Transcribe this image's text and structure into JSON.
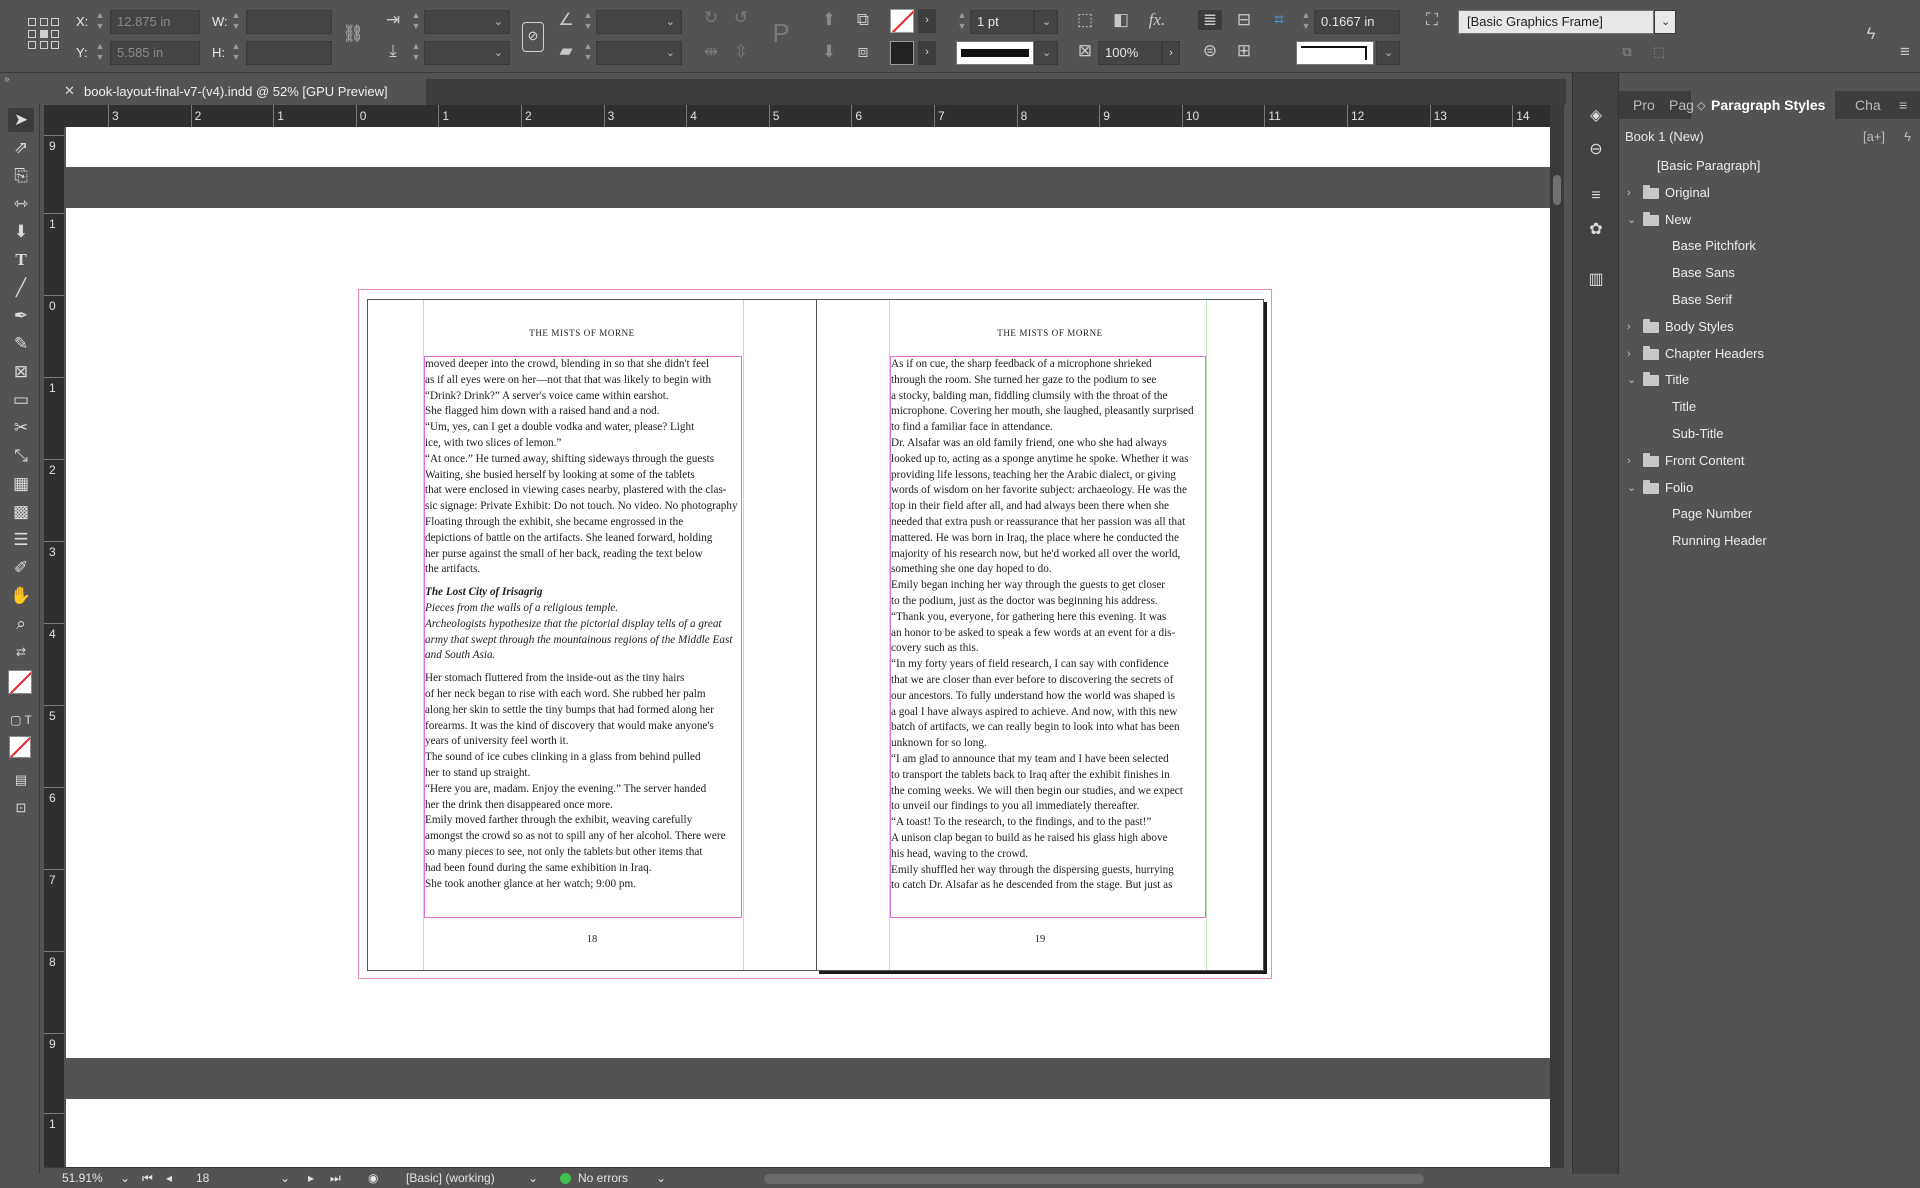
{
  "control": {
    "x_label": "X:",
    "x_value": "12.875 in",
    "y_label": "Y:",
    "y_value": "5.585 in",
    "w_label": "W:",
    "w_value": "",
    "h_label": "H:",
    "h_value": "",
    "stroke_weight": "1 pt",
    "opacity": "100%",
    "offset_value": "0.1667 in",
    "object_style": "[Basic Graphics Frame]"
  },
  "document_tab": {
    "title": "book-layout-final-v7-(v4).indd @ 52% [GPU Preview]"
  },
  "ruler_h_labels": [
    "3",
    "2",
    "1",
    "0",
    "1",
    "2",
    "3",
    "4",
    "5",
    "6",
    "7",
    "8",
    "9",
    "10",
    "11",
    "12",
    "13",
    "14"
  ],
  "ruler_v_labels": [
    "9",
    "1",
    "0",
    "1",
    "2",
    "3",
    "4",
    "5",
    "6",
    "7",
    "8",
    "9",
    "1"
  ],
  "left_page": {
    "running_header": "THE MISTS OF MORNE",
    "folio": "18",
    "lines": [
      {
        "t": "moved deeper into the crowd, blending in so that she didn't feel",
        "s": ""
      },
      {
        "t": "as if all eyes were on her—not that that was likely to begin with",
        "s": ""
      },
      {
        "t": "     “Drink? Drink?” A server's voice came within earshot.",
        "s": ""
      },
      {
        "t": "     She flagged him down with a raised hand and a nod.",
        "s": ""
      },
      {
        "t": "     “Um, yes, can I get a double vodka and water, please? Light",
        "s": ""
      },
      {
        "t": "ice, with two slices of lemon.”",
        "s": ""
      },
      {
        "t": "     “At once.” He turned away, shifting sideways through the guests",
        "s": ""
      },
      {
        "t": "     Waiting, she busied herself by looking at some of the tablets",
        "s": ""
      },
      {
        "t": "that were enclosed in viewing cases nearby, plastered with the clas-",
        "s": ""
      },
      {
        "t": "sic signage: Private Exhibit: Do not touch. No video. No photography",
        "s": ""
      },
      {
        "t": "     Floating through the exhibit, she became engrossed in the",
        "s": ""
      },
      {
        "t": "depictions of battle on the artifacts. She leaned forward, holding",
        "s": ""
      },
      {
        "t": "her purse against the small of her back, reading the text below",
        "s": ""
      },
      {
        "t": "the artifacts.",
        "s": ""
      },
      {
        "t": "",
        "s": "gap"
      },
      {
        "t": "     The Lost City of Irisagrig",
        "s": "bi"
      },
      {
        "t": "     Pieces from the walls of a religious temple.",
        "s": "it"
      },
      {
        "t": "     Archeologists hypothesize that the pictorial display tells of a great",
        "s": "it"
      },
      {
        "t": "army that swept through the mountainous regions of the Middle East",
        "s": "it"
      },
      {
        "t": "and South Asia.",
        "s": "it"
      },
      {
        "t": "",
        "s": "gap"
      },
      {
        "t": "     Her stomach fluttered from the inside-out as the tiny hairs",
        "s": ""
      },
      {
        "t": "of her neck began to rise with each word. She rubbed her palm",
        "s": ""
      },
      {
        "t": "along her skin to settle the tiny bumps that had formed along her",
        "s": ""
      },
      {
        "t": "forearms. It was the kind of discovery that would make anyone's",
        "s": ""
      },
      {
        "t": "years of university feel worth it.",
        "s": ""
      },
      {
        "t": "     The sound of ice cubes clinking in a glass from behind pulled",
        "s": ""
      },
      {
        "t": "her to stand up straight.",
        "s": ""
      },
      {
        "t": "     “Here you are, madam. Enjoy the evening.” The server handed",
        "s": ""
      },
      {
        "t": "her the drink then disappeared once more.",
        "s": ""
      },
      {
        "t": "     Emily moved farther through the exhibit, weaving carefully",
        "s": ""
      },
      {
        "t": "amongst the crowd so as not to spill any of her alcohol. There were",
        "s": ""
      },
      {
        "t": "so many pieces to see, not only the tablets but other items that",
        "s": ""
      },
      {
        "t": "had been found during the same exhibition in Iraq.",
        "s": ""
      },
      {
        "t": "     She took another glance at her watch; 9:00 pm.",
        "s": ""
      }
    ]
  },
  "right_page": {
    "running_header": "THE MISTS OF MORNE",
    "folio": "19",
    "lines": [
      {
        "t": "     As if on cue, the sharp feedback of a microphone shrieked",
        "s": ""
      },
      {
        "t": "through the room. She turned her gaze to the podium to see",
        "s": ""
      },
      {
        "t": "a stocky, balding man, fiddling clumsily with the throat of the",
        "s": ""
      },
      {
        "t": "microphone. Covering her mouth, she laughed, pleasantly surprised",
        "s": ""
      },
      {
        "t": "to find a familiar face in attendance.",
        "s": ""
      },
      {
        "t": "     Dr. Alsafar was an old family friend, one who she had always",
        "s": ""
      },
      {
        "t": "looked up to, acting as a sponge anytime he spoke. Whether it was",
        "s": ""
      },
      {
        "t": "providing life lessons, teaching her the Arabic dialect, or giving",
        "s": ""
      },
      {
        "t": "words of wisdom on her favorite subject: archaeology. He was the",
        "s": ""
      },
      {
        "t": "top in their field after all, and had always been there when she",
        "s": ""
      },
      {
        "t": "needed that extra push or reassurance that her passion was all that",
        "s": ""
      },
      {
        "t": "mattered. He was born in Iraq, the place where he conducted the",
        "s": ""
      },
      {
        "t": "majority of his research now, but he'd worked all over the world,",
        "s": ""
      },
      {
        "t": "something she one day hoped to do.",
        "s": ""
      },
      {
        "t": "     Emily began inching her way through the guests to get closer",
        "s": ""
      },
      {
        "t": "to the podium, just as the doctor was beginning his address.",
        "s": ""
      },
      {
        "t": "     “Thank you, everyone, for gathering here this evening. It was",
        "s": ""
      },
      {
        "t": "an honor to be asked to speak a few words at an event for a dis-",
        "s": ""
      },
      {
        "t": "covery such as this.",
        "s": ""
      },
      {
        "t": "     “In my forty years of field research, I can say with confidence",
        "s": ""
      },
      {
        "t": "that we are closer than ever before to discovering the secrets of",
        "s": ""
      },
      {
        "t": "our ancestors. To fully understand how the world was shaped is",
        "s": ""
      },
      {
        "t": "a goal I have always aspired to achieve. And now, with this new",
        "s": ""
      },
      {
        "t": "batch of artifacts, we can really begin to look into what has been",
        "s": ""
      },
      {
        "t": "unknown for so long.",
        "s": ""
      },
      {
        "t": "     “I am glad to announce that my team and I have been selected",
        "s": ""
      },
      {
        "t": "to transport the tablets back to Iraq after the exhibit finishes in",
        "s": ""
      },
      {
        "t": "the coming weeks. We will then begin our studies, and we expect",
        "s": ""
      },
      {
        "t": "to unveil our findings to you all immediately thereafter.",
        "s": ""
      },
      {
        "t": "     “A toast! To the research, to the findings, and to the past!”",
        "s": ""
      },
      {
        "t": "     A unison clap began to build as he raised his glass high above",
        "s": ""
      },
      {
        "t": "his head, waving to the crowd.",
        "s": ""
      },
      {
        "t": "     Emily shuffled her way through the dispersing guests, hurrying",
        "s": ""
      },
      {
        "t": "to catch Dr. Alsafar as he descended from the stage. But just as",
        "s": ""
      }
    ]
  },
  "panel": {
    "tabs": [
      "Pro",
      "Pag",
      "Paragraph Styles",
      "Cha"
    ],
    "book_name": "Book 1 (New)",
    "tree": [
      {
        "label": "[Basic Paragraph]",
        "level": 1,
        "folder": false,
        "twisty": ""
      },
      {
        "label": "Original",
        "level": 1,
        "folder": true,
        "twisty": "›"
      },
      {
        "label": "New",
        "level": 1,
        "folder": true,
        "twisty": "⌄"
      },
      {
        "label": "Base Pitchfork",
        "level": 2,
        "folder": false,
        "twisty": ""
      },
      {
        "label": "Base Sans",
        "level": 2,
        "folder": false,
        "twisty": ""
      },
      {
        "label": "Base Serif",
        "level": 2,
        "folder": false,
        "twisty": ""
      },
      {
        "label": "Body Styles",
        "level": 1,
        "folder": true,
        "twisty": "›"
      },
      {
        "label": "Chapter Headers",
        "level": 1,
        "folder": true,
        "twisty": "›"
      },
      {
        "label": "Title",
        "level": 1,
        "folder": true,
        "twisty": "⌄"
      },
      {
        "label": "Title",
        "level": 2,
        "folder": false,
        "twisty": ""
      },
      {
        "label": "Sub-Title",
        "level": 2,
        "folder": false,
        "twisty": ""
      },
      {
        "label": "Front Content",
        "level": 1,
        "folder": true,
        "twisty": "›"
      },
      {
        "label": "Folio",
        "level": 1,
        "folder": true,
        "twisty": "⌄"
      },
      {
        "label": "Page Number",
        "level": 2,
        "folder": false,
        "twisty": ""
      },
      {
        "label": "Running Header",
        "level": 2,
        "folder": false,
        "twisty": ""
      }
    ]
  },
  "status": {
    "zoom": "51.91%",
    "page": "18",
    "profile": "[Basic] (working)",
    "preflight": "No errors"
  },
  "colors": {
    "ui_bg": "#535353",
    "ruler_bg": "#2f2f2f",
    "frame_edge": "#e06fd8",
    "bleed": "#ee8fa6",
    "column_guide": "#b9e6b9",
    "preflight_ok": "#3fbf4f"
  }
}
